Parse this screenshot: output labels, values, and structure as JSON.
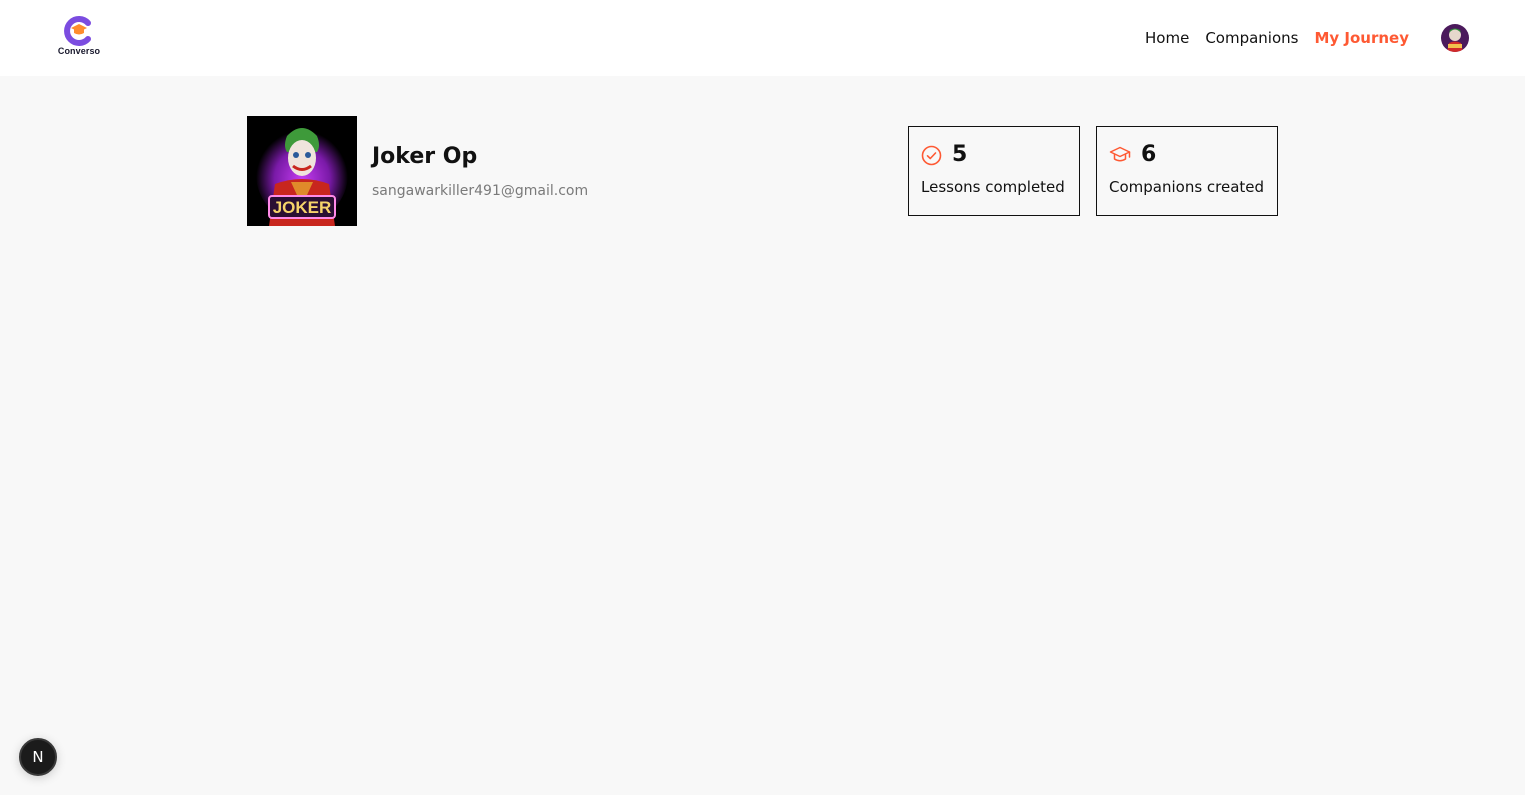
{
  "header": {
    "logo_text": "Converso",
    "nav": [
      {
        "label": "Home",
        "active": false
      },
      {
        "label": "Companions",
        "active": false
      },
      {
        "label": "My Journey",
        "active": true
      }
    ],
    "avatar_icon": "user-avatar-joker"
  },
  "profile": {
    "name": "Joker Op",
    "email": "sangawarkiller491@gmail.com",
    "avatar_icon": "joker-avatar",
    "avatar_text": "JOKER"
  },
  "stats": [
    {
      "value": "5",
      "label": "Lessons completed",
      "icon": "check-circle-icon"
    },
    {
      "value": "6",
      "label": "Companions created",
      "icon": "graduation-cap-icon"
    }
  ],
  "dev_badge": {
    "label": "N",
    "icon": "nextjs-icon"
  },
  "colors": {
    "accent": "#fe5933",
    "brand_purple": "#7b4ce0",
    "background": "#f8f8f8",
    "navbar": "#ffffff"
  }
}
